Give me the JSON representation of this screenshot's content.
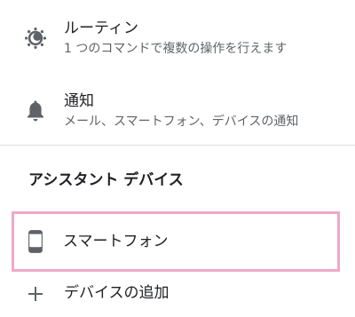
{
  "routine": {
    "icon": "routine-sun-icon",
    "title": "ルーティン",
    "subtitle": "1 つのコマンドで複数の操作を行えます"
  },
  "notifications": {
    "icon": "bell-icon",
    "title": "通知",
    "subtitle": "メール、スマートフォン、デバイスの通知"
  },
  "assistant_devices": {
    "header": "アシスタント デバイス",
    "devices": [
      {
        "icon": "smartphone-icon",
        "label": "スマートフォン"
      }
    ],
    "add_device": {
      "icon": "plus-icon",
      "label": "デバイスの追加"
    }
  },
  "colors": {
    "highlight_border": "#f0a9c8",
    "icon": "#5f6368",
    "primary_text": "#202124",
    "secondary_text": "#5f6368",
    "divider": "#e0e0e0"
  }
}
